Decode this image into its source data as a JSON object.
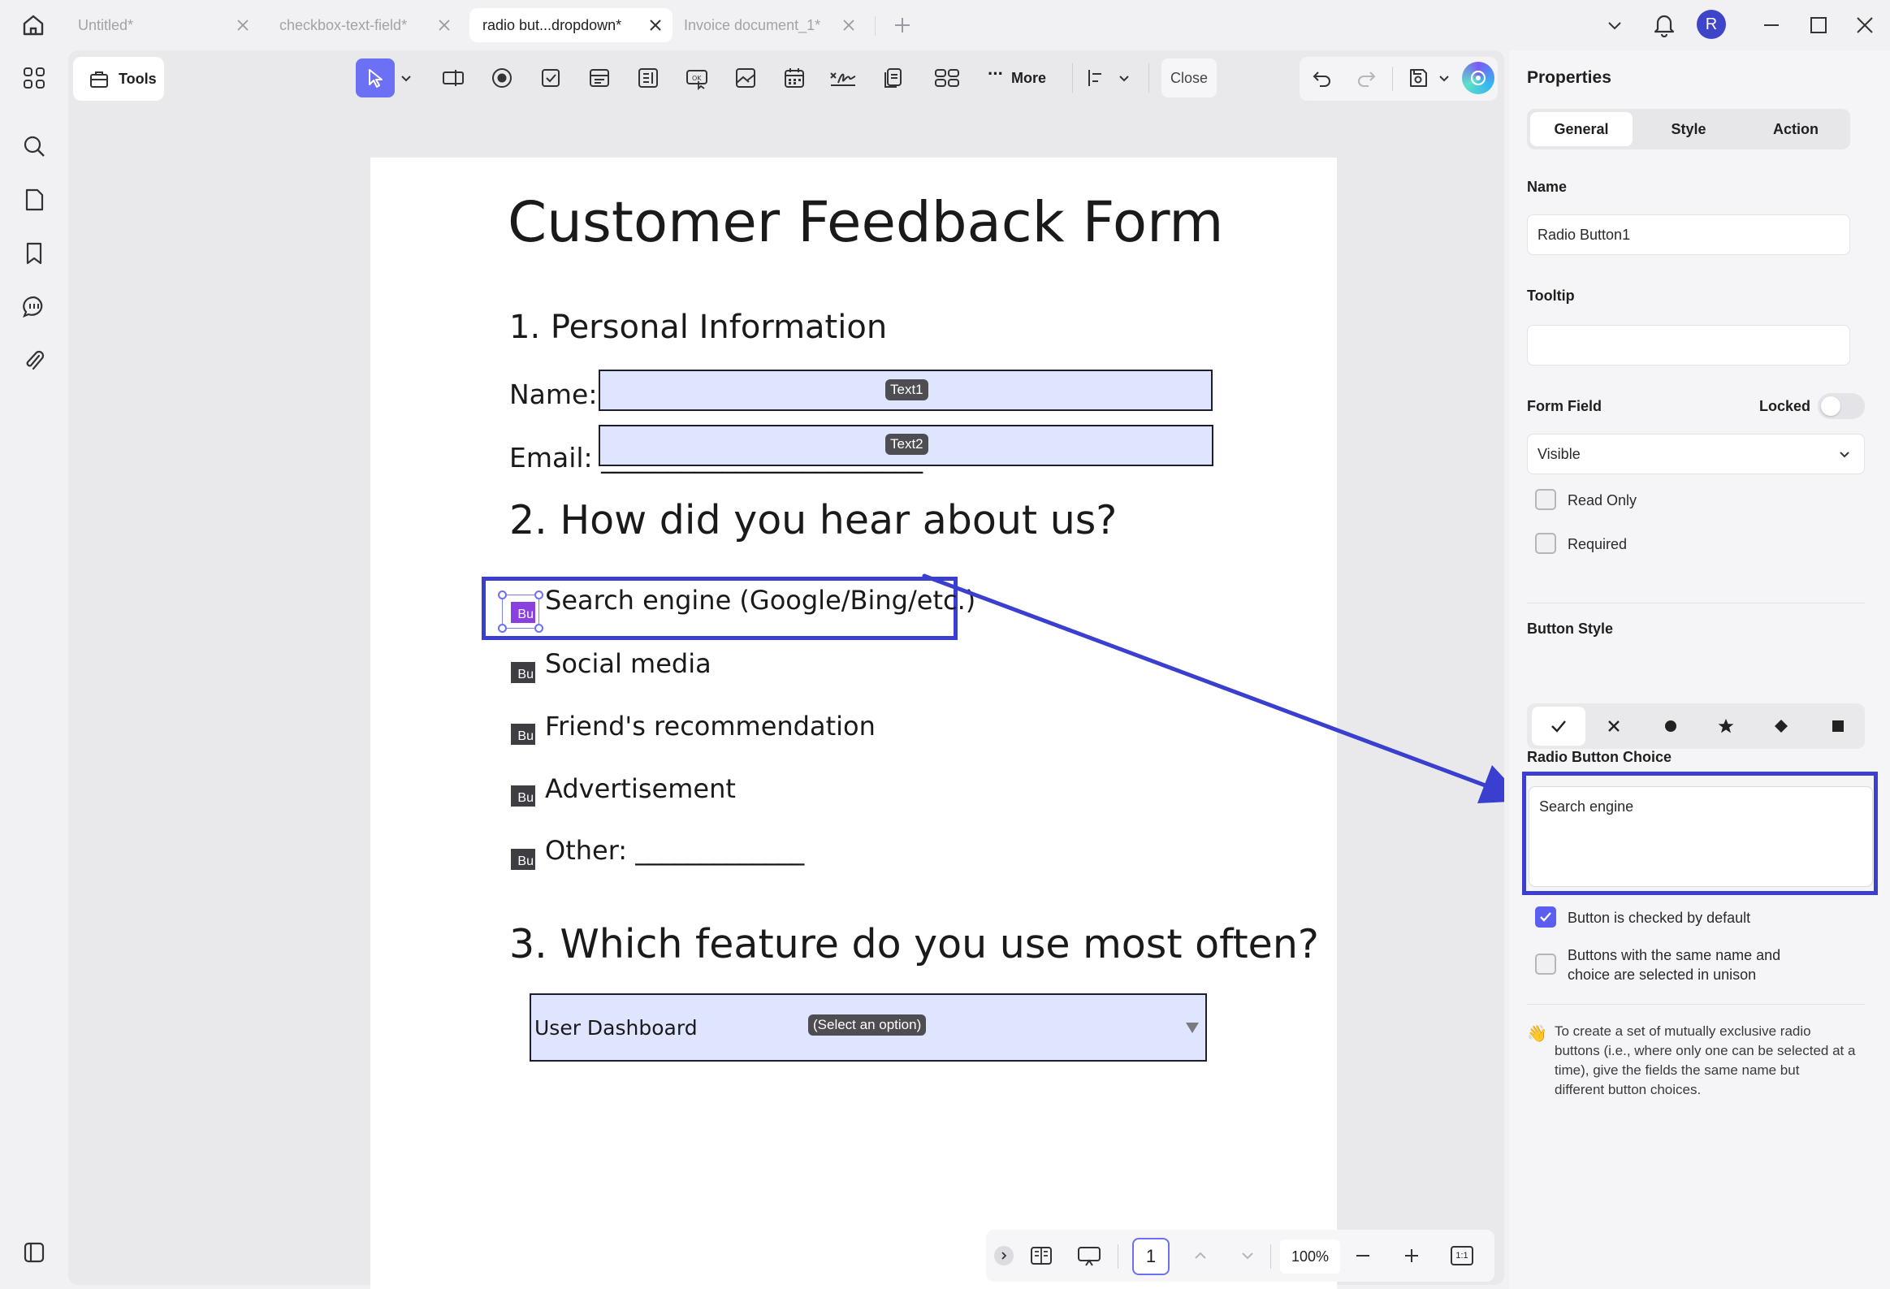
{
  "tabs": [
    {
      "label": "Untitled*"
    },
    {
      "label": "checkbox-text-field*"
    },
    {
      "label": "radio but...dropdown*"
    },
    {
      "label": "Invoice document_1*"
    }
  ],
  "user": {
    "avatar_initial": "R"
  },
  "toolbar": {
    "tools_label": "Tools",
    "more_label": "More",
    "close_label": "Close"
  },
  "document": {
    "title": "Customer Feedback Form",
    "section1": "1. Personal Information",
    "name_label": "Name: _",
    "email_label": "Email: ________________________",
    "field_text1": "Text1",
    "field_text2": "Text2",
    "section2": "2. How did you hear about us?",
    "radio_tag": "Bu",
    "options": [
      "Search engine (Google/Bing/etc.)",
      "Social media",
      "Friend's recommendation",
      "Advertisement",
      "Other: _____________"
    ],
    "section3": "3. Which feature do you use most often?",
    "dropdown_value": "User Dashboard",
    "dropdown_placeholder": "(Select an option)"
  },
  "bottombar": {
    "page": "1",
    "zoom": "100%",
    "fit": "1:1"
  },
  "properties": {
    "title": "Properties",
    "tabs": [
      "General",
      "Style",
      "Action"
    ],
    "name_label": "Name",
    "name_value": "Radio Button1",
    "tooltip_label": "Tooltip",
    "tooltip_value": "",
    "form_field_label": "Form Field",
    "locked_label": "Locked",
    "visibility_value": "Visible",
    "read_only_label": "Read Only",
    "required_label": "Required",
    "button_style_label": "Button Style",
    "radio_choice_label": "Radio Button Choice",
    "radio_choice_value": "Search engine",
    "checked_default_label": "Button is checked by default",
    "unison_label_1": "Buttons with the same name and",
    "unison_label_2": "choice are selected in unison",
    "tip_icon": "👋",
    "tip_lines": [
      "To create a set of mutually exclusive radio",
      "buttons (i.e., where only one can be selected at a",
      "time), give the fields the same name but",
      "different button choices."
    ]
  },
  "colors": {
    "accent": "#5a5ff0",
    "annotation": "#3b3fcf",
    "field_fill": "#dfe4ff"
  }
}
